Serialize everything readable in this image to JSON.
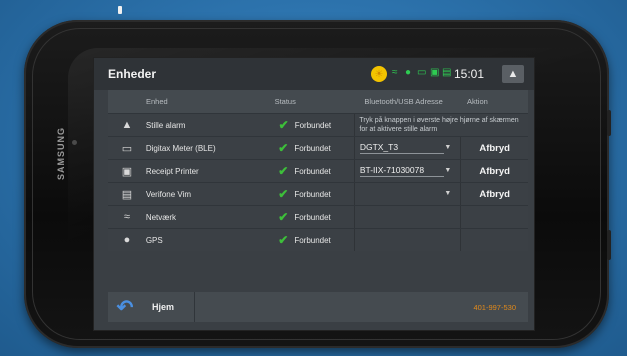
{
  "device": {
    "brand": "SAMSUNG"
  },
  "header": {
    "title": "Enheder",
    "time": "15:01"
  },
  "table": {
    "columns": {
      "device": "Enhed",
      "status": "Status",
      "address": "Bluetooth/USB Adresse",
      "action": "Aktion"
    },
    "rows": [
      {
        "name": "Stille alarm",
        "status": "Forbundet",
        "info": "Tryk på knappen i øverste højre hjørne af skærmen for at aktivere stille alarm"
      },
      {
        "name": "Digitax Meter (BLE)",
        "status": "Forbundet",
        "address": "DGTX_T3",
        "action": "Afbryd"
      },
      {
        "name": "Receipt Printer",
        "status": "Forbundet",
        "address": "BT-IIX-71030078",
        "action": "Afbryd"
      },
      {
        "name": "Verifone Vim",
        "status": "Forbundet",
        "address": "",
        "action": "Afbryd"
      },
      {
        "name": "Netværk",
        "status": "Forbundet"
      },
      {
        "name": "GPS",
        "status": "Forbundet"
      }
    ]
  },
  "footer": {
    "home_label": "Hjem",
    "code": "401-997-530"
  },
  "icons": {
    "alarm": "warning-icon",
    "meter": "meter-icon",
    "printer": "printer-icon",
    "card": "card-reader-icon",
    "network": "wifi-icon",
    "gps": "gps-pin-icon",
    "back": "back-arrow-icon"
  },
  "colors": {
    "check": "#3dbf3a",
    "accent_blue": "#4a90e2",
    "code_orange": "#e0891b",
    "status_green": "#2ecc52",
    "sun_yellow": "#f3c300"
  }
}
